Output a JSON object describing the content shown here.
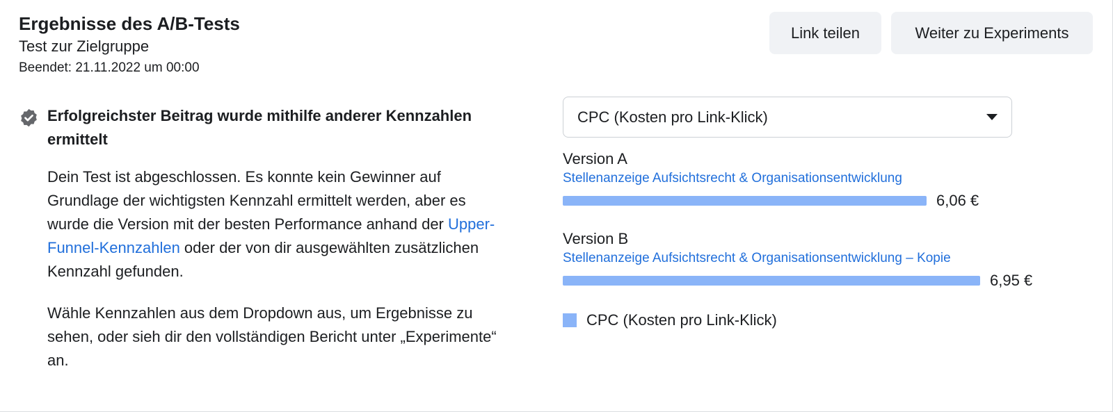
{
  "header": {
    "title": "Ergebnisse des A/B-Tests",
    "subtitle": "Test zur Zielgruppe",
    "ended": "Beendet: 21.11.2022 um 00:00"
  },
  "buttons": {
    "share": "Link teilen",
    "experiments": "Weiter zu Experiments"
  },
  "summary": {
    "icon": "verified-check-icon",
    "heading": "Erfolgreichster Beitrag wurde mithilfe anderer Kennzahlen ermittelt",
    "para1_before": "Dein Test ist abgeschlossen. Es konnte kein Gewinner auf Grundlage der wichtigsten Kennzahl ermittelt werden, aber es wurde die Version mit der besten Performance anhand der ",
    "para1_link": "Upper-Funnel-Kennzahlen",
    "para1_after": " oder der von dir ausgewählten zusätzlichen Kennzahl gefunden.",
    "para2": "Wähle Kennzahlen aus dem Dropdown aus, um Ergebnisse zu sehen, oder sieh dir den vollständigen Bericht unter „Experimente“ an."
  },
  "metric_select": {
    "selected": "CPC (Kosten pro Link-Klick)"
  },
  "colors": {
    "bar": "#8ab4f8",
    "link": "#216fdb"
  },
  "chart_data": {
    "type": "bar",
    "categories": [
      "Version A",
      "Version B"
    ],
    "series": [
      {
        "name": "CPC (Kosten pro Link-Klick)",
        "values": [
          6.06,
          6.95
        ]
      }
    ],
    "labels": [
      "6,06 €",
      "6,95 €"
    ],
    "sublabels": [
      "Stellenanzeige Aufsichtsrecht & Organisationsentwicklung",
      "Stellenanzeige Aufsichtsrecht & Organisationsentwicklung – Kopie"
    ],
    "legend": [
      "CPC (Kosten pro Link-Klick)"
    ],
    "orientation": "horizontal"
  }
}
